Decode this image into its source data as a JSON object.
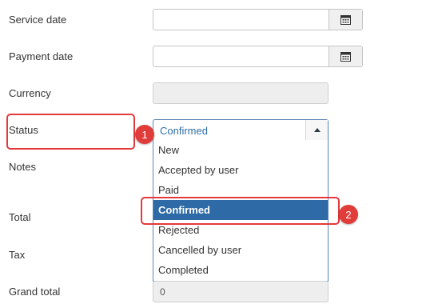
{
  "form": {
    "service_date_label": "Service date",
    "payment_date_label": "Payment date",
    "currency_label": "Currency",
    "status_label": "Status",
    "notes_label": "Notes",
    "total_label": "Total",
    "tax_label": "Tax",
    "grand_total_label": "Grand total",
    "grand_total_value": "0"
  },
  "status_select": {
    "selected": "Confirmed",
    "options": [
      "New",
      "Accepted by user",
      "Paid",
      "Confirmed",
      "Rejected",
      "Cancelled by user",
      "Completed"
    ]
  },
  "annotations": {
    "marker_1": "1",
    "marker_2": "2"
  },
  "colors": {
    "accent": "#2d6aa6",
    "annotation_red": "#e5383a"
  }
}
